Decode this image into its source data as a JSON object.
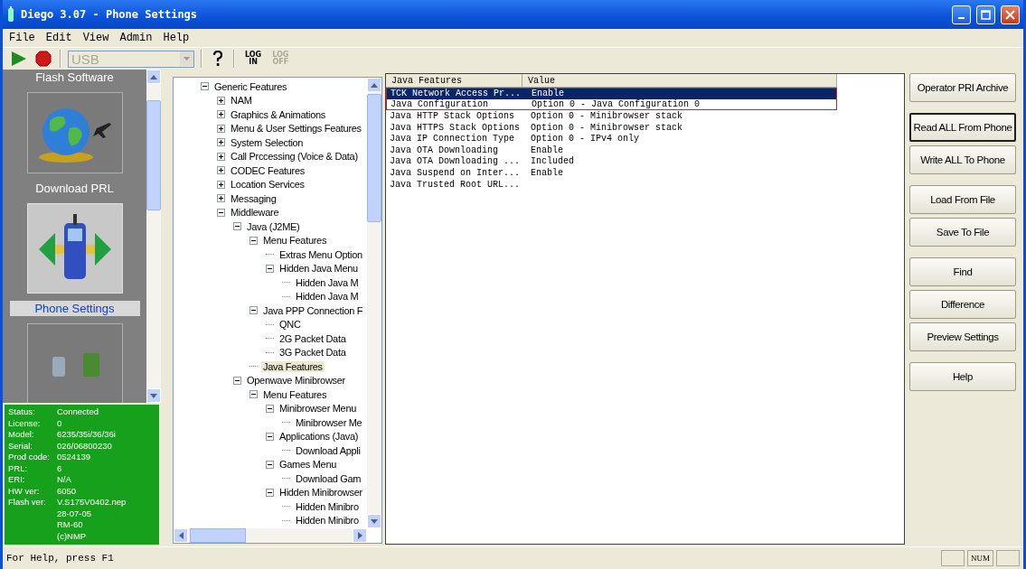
{
  "window": {
    "title": "Diego 3.07 - Phone Settings"
  },
  "menu": [
    {
      "label": "File"
    },
    {
      "label": "Edit"
    },
    {
      "label": "View"
    },
    {
      "label": "Admin"
    },
    {
      "label": "Help"
    }
  ],
  "toolbar": {
    "port": {
      "value": "USB",
      "disabled": true
    },
    "log_in": {
      "lines": [
        "LOG",
        "IN"
      ],
      "disabled": false
    },
    "log_off": {
      "lines": [
        "LOG",
        "OFF"
      ],
      "disabled": true
    }
  },
  "nav": [
    {
      "kind": "text-only",
      "label": "Flash Software",
      "selected": false
    },
    {
      "kind": "globe",
      "label": "Download PRL",
      "selected": false
    },
    {
      "kind": "phone",
      "label": "Phone Settings",
      "selected": true
    },
    {
      "kind": "handsets",
      "selected": false
    }
  ],
  "phone_info": [
    {
      "label": "Status:",
      "value": "Connected"
    },
    {
      "label": "License:",
      "value": "0"
    },
    {
      "label": "Model:",
      "value": "6235/35i/36/36i"
    },
    {
      "label": "Serial:",
      "value": "026/06800230"
    },
    {
      "label": "Prod code:",
      "value": "0524139"
    },
    {
      "label": "PRL:",
      "value": "6"
    },
    {
      "label": "ERI:",
      "value": "N/A"
    },
    {
      "label": "HW ver:",
      "value": "6050"
    },
    {
      "label": "Flash ver:",
      "value": "V.S175V0402.nep"
    },
    {
      "value": "28-07-05"
    },
    {
      "value": "RM-60"
    },
    {
      "value": "(c)NMP"
    }
  ],
  "tree": {
    "items": [
      {
        "label": "Generic Features",
        "expanded": true,
        "selected": false,
        "children": [
          {
            "label": "NAM",
            "expanded": false,
            "selected": false
          },
          {
            "label": "Graphics & Animations",
            "expanded": false,
            "selected": false
          },
          {
            "label": "Menu & User Settings Features",
            "expanded": false,
            "selected": false
          },
          {
            "label": "System Selection",
            "expanded": false,
            "selected": false
          },
          {
            "label": "Call Prccessing (Voice & Data)",
            "expanded": false,
            "selected": false
          },
          {
            "label": "CODEC Features",
            "expanded": false,
            "selected": false
          },
          {
            "label": "Location Services",
            "expanded": false,
            "selected": false
          },
          {
            "label": "Messaging",
            "expanded": false,
            "selected": false
          },
          {
            "label": "Middleware",
            "expanded": true,
            "selected": false,
            "children": [
              {
                "label": "Java (J2ME)",
                "expanded": true,
                "selected": false,
                "children": [
                  {
                    "label": "Menu Features",
                    "expanded": true,
                    "selected": false,
                    "children": [
                      {
                        "label": "Extras Menu Option",
                        "selected": false
                      },
                      {
                        "label": "Hidden Java Menu",
                        "expanded": true,
                        "selected": false,
                        "children": [
                          {
                            "label": "Hidden Java M",
                            "selected": false
                          },
                          {
                            "label": "Hidden Java M",
                            "selected": false
                          }
                        ]
                      }
                    ]
                  },
                  {
                    "label": "Java PPP Connection F",
                    "expanded": true,
                    "selected": false,
                    "children": [
                      {
                        "label": "QNC",
                        "selected": false
                      },
                      {
                        "label": "2G Packet Data",
                        "selected": false
                      },
                      {
                        "label": "3G Packet Data",
                        "selected": false
                      }
                    ]
                  },
                  {
                    "label": "Java Features",
                    "selected": true
                  }
                ]
              },
              {
                "label": "Openwave Minibrowser",
                "expanded": true,
                "selected": false,
                "children": [
                  {
                    "label": "Menu Features",
                    "expanded": true,
                    "selected": false,
                    "children": [
                      {
                        "label": "Minibrowser Menu",
                        "expanded": true,
                        "selected": false,
                        "children": [
                          {
                            "label": "Minibrowser Me",
                            "selected": false
                          }
                        ]
                      },
                      {
                        "label": "Applications (Java)",
                        "expanded": true,
                        "selected": false,
                        "children": [
                          {
                            "label": "Download Appli",
                            "selected": false
                          }
                        ]
                      },
                      {
                        "label": "Games Menu",
                        "expanded": true,
                        "selected": false,
                        "children": [
                          {
                            "label": "Download Gam",
                            "selected": false
                          }
                        ]
                      },
                      {
                        "label": "Hidden Minibrowser",
                        "expanded": true,
                        "selected": false,
                        "children": [
                          {
                            "label": "Hidden Minibro",
                            "selected": false
                          },
                          {
                            "label": "Hidden Minibro",
                            "selected": false
                          }
                        ]
                      }
                    ]
                  }
                ]
              }
            ]
          }
        ]
      }
    ]
  },
  "table": {
    "columns": [
      "Java Features",
      "Value"
    ],
    "rows": [
      {
        "cells": [
          "TCK Network Access Pr...",
          "Enable"
        ],
        "selected": true,
        "highlighted": true
      },
      {
        "cells": [
          "Java Configuration",
          "Option 0 - Java Configuration 0"
        ],
        "selected": false,
        "highlighted": true
      },
      {
        "cells": [
          "Java HTTP Stack Options",
          "Option 0 - Minibrowser stack"
        ],
        "selected": false,
        "highlighted": false
      },
      {
        "cells": [
          "Java HTTPS Stack Options",
          "Option 0 - Minibrowser stack"
        ],
        "selected": false,
        "highlighted": false
      },
      {
        "cells": [
          "Java IP Connection Type",
          "Option 0 - IPv4 only"
        ],
        "selected": false,
        "highlighted": false
      },
      {
        "cells": [
          "Java OTA Downloading",
          "Enable"
        ],
        "selected": false,
        "highlighted": false
      },
      {
        "cells": [
          "Java OTA Downloading ...",
          "Included"
        ],
        "selected": false,
        "highlighted": false
      },
      {
        "cells": [
          "Java Suspend on Inter...",
          "Enable"
        ],
        "selected": false,
        "highlighted": false
      },
      {
        "cells": [
          "Java Trusted Root URL..."
        ],
        "selected": false,
        "highlighted": false
      }
    ]
  },
  "button_groups": [
    [
      {
        "label": "Operator PRI Archive",
        "default": false
      }
    ],
    [
      {
        "label": "Read ALL From Phone",
        "default": true
      },
      {
        "label": "Write ALL To Phone",
        "default": false
      }
    ],
    [
      {
        "label": "Load From File",
        "default": false
      },
      {
        "label": "Save To File",
        "default": false
      }
    ],
    [
      {
        "label": "Find",
        "default": false
      },
      {
        "label": "Difference",
        "default": false
      },
      {
        "label": "Preview Settings",
        "default": false
      }
    ],
    [
      {
        "label": "Help",
        "default": false
      }
    ]
  ],
  "status_bar": {
    "text": "For Help, press F1",
    "indicators": [
      {
        "label": "NUM"
      }
    ]
  }
}
